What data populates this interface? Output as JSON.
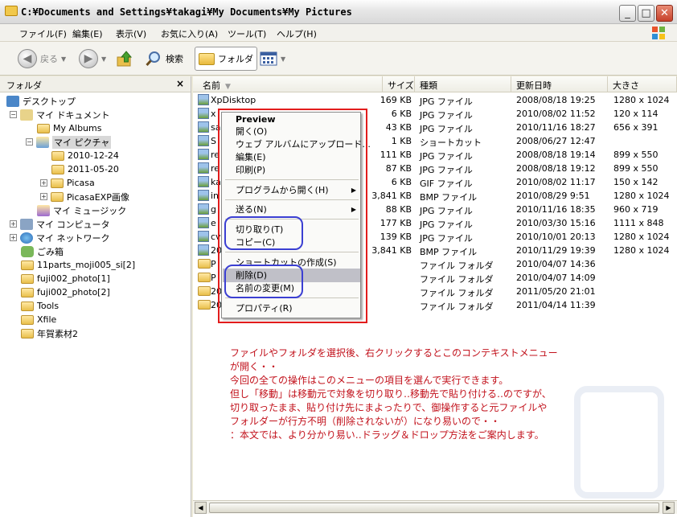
{
  "window": {
    "title": "C:¥Documents and Settings¥takagi¥My Documents¥My Pictures",
    "controls": {
      "minimize": "_",
      "maximize": "□",
      "close": "✕"
    }
  },
  "menubar": [
    "ファイル(F)",
    "編集(E)",
    "表示(V)",
    "お気に入り(A)",
    "ツール(T)",
    "ヘルプ(H)"
  ],
  "toolbar": {
    "back": "戻る",
    "search": "検索",
    "folders": "フォルダ"
  },
  "tree": {
    "header": "フォルダ",
    "close": "×",
    "items": [
      {
        "label": "デスクトップ"
      },
      {
        "label": "マイ ドキュメント"
      },
      {
        "label": "My Albums"
      },
      {
        "label": "マイ ピクチャ"
      },
      {
        "label": "2010-12-24"
      },
      {
        "label": "2011-05-20"
      },
      {
        "label": "Picasa"
      },
      {
        "label": "PicasaEXP画像"
      },
      {
        "label": "マイ ミュージック"
      },
      {
        "label": "マイ コンピュータ"
      },
      {
        "label": "マイ ネットワーク"
      },
      {
        "label": "ごみ箱"
      },
      {
        "label": "11parts_moji005_si[2]"
      },
      {
        "label": "fuji002_photo[1]"
      },
      {
        "label": "fuji002_photo[2]"
      },
      {
        "label": "Tools"
      },
      {
        "label": "Xfile"
      },
      {
        "label": "年賀素材2"
      }
    ]
  },
  "list": {
    "columns": [
      "名前",
      "サイズ",
      "種類",
      "更新日時",
      "大きさ"
    ],
    "rows": [
      {
        "name": "XpDisktop",
        "size": "169 KB",
        "type": "JPG ファイル",
        "date": "2008/08/18 19:25",
        "dim": "1280 x 1024"
      },
      {
        "name": "x",
        "size": "6 KB",
        "type": "JPG ファイル",
        "date": "2010/08/02 11:52",
        "dim": "120 x 114"
      },
      {
        "name": "sa",
        "size": "43 KB",
        "type": "JPG ファイル",
        "date": "2010/11/16 18:27",
        "dim": "656 x 391"
      },
      {
        "name": "S",
        "size": "1 KB",
        "type": "ショートカット",
        "date": "2008/06/27 12:47",
        "dim": ""
      },
      {
        "name": "re",
        "size": "111 KB",
        "type": "JPG ファイル",
        "date": "2008/08/18 19:14",
        "dim": "899 x 550"
      },
      {
        "name": "re",
        "size": "87 KB",
        "type": "JPG ファイル",
        "date": "2008/08/18 19:12",
        "dim": "899 x 550"
      },
      {
        "name": "ka",
        "size": "6 KB",
        "type": "GIF ファイル",
        "date": "2010/08/02 11:17",
        "dim": "150 x 142"
      },
      {
        "name": "in",
        "size": "3,841 KB",
        "type": "BMP ファイル",
        "date": "2010/08/29 9:51",
        "dim": "1280 x 1024"
      },
      {
        "name": "g",
        "size": "88 KB",
        "type": "JPG ファイル",
        "date": "2010/11/16 18:35",
        "dim": "960 x 719"
      },
      {
        "name": "e",
        "size": "177 KB",
        "type": "JPG ファイル",
        "date": "2010/03/30 15:16",
        "dim": "1111 x 848"
      },
      {
        "name": "cv",
        "size": "139 KB",
        "type": "JPG ファイル",
        "date": "2010/10/01 20:13",
        "dim": "1280 x 1024"
      },
      {
        "name": "20",
        "size": "3,841 KB",
        "type": "BMP ファイル",
        "date": "2010/11/29 19:39",
        "dim": "1280 x 1024"
      },
      {
        "name": "P",
        "size": "",
        "type": "ファイル フォルダ",
        "date": "2010/04/07 14:36",
        "dim": ""
      },
      {
        "name": "P",
        "size": "",
        "type": "ファイル フォルダ",
        "date": "2010/04/07 14:09",
        "dim": ""
      },
      {
        "name": "20",
        "size": "",
        "type": "ファイル フォルダ",
        "date": "2011/05/20 21:01",
        "dim": ""
      },
      {
        "name": "20",
        "size": "",
        "type": "ファイル フォルダ",
        "date": "2011/04/14 11:39",
        "dim": ""
      }
    ]
  },
  "context_menu": {
    "items": [
      {
        "label": "Preview"
      },
      {
        "label": "開く(O)"
      },
      {
        "label": "ウェブ アルバムにアップロード..."
      },
      {
        "label": "編集(E)"
      },
      {
        "label": "印刷(P)"
      },
      {
        "label": "プログラムから開く(H)",
        "arrow": "▶"
      },
      {
        "label": "送る(N)",
        "arrow": "▶"
      },
      {
        "label": "切り取り(T)"
      },
      {
        "label": "コピー(C)"
      },
      {
        "label": "ショートカットの作成(S)"
      },
      {
        "label": "削除(D)"
      },
      {
        "label": "名前の変更(M)"
      },
      {
        "label": "プロパティ(R)"
      }
    ]
  },
  "annotation": {
    "lines": [
      "ファイルやフォルダを選択後、右クリックするとこのコンテキストメニュー",
      "が開く・・",
      "今回の全ての操作はこのメニューの項目を選んで実行できます。",
      "但し「移動」は移動元で対象を切り取り‥移動先で貼り付ける‥のですが、",
      "切り取ったまま、貼り付け先にまよったりで、御操作すると元ファイルや",
      "フォルダーが行方不明（削除されないが）になり易いので・・",
      "：本文では、より分かり易い‥ドラッグ＆ドロップ方法をご案内します。"
    ]
  },
  "colors": {
    "annotation_text": "#c2121c",
    "red_frame": "#e21c1c",
    "blue_frame": "#3b3fd2",
    "menu_highlight": "#c0c0c8"
  }
}
